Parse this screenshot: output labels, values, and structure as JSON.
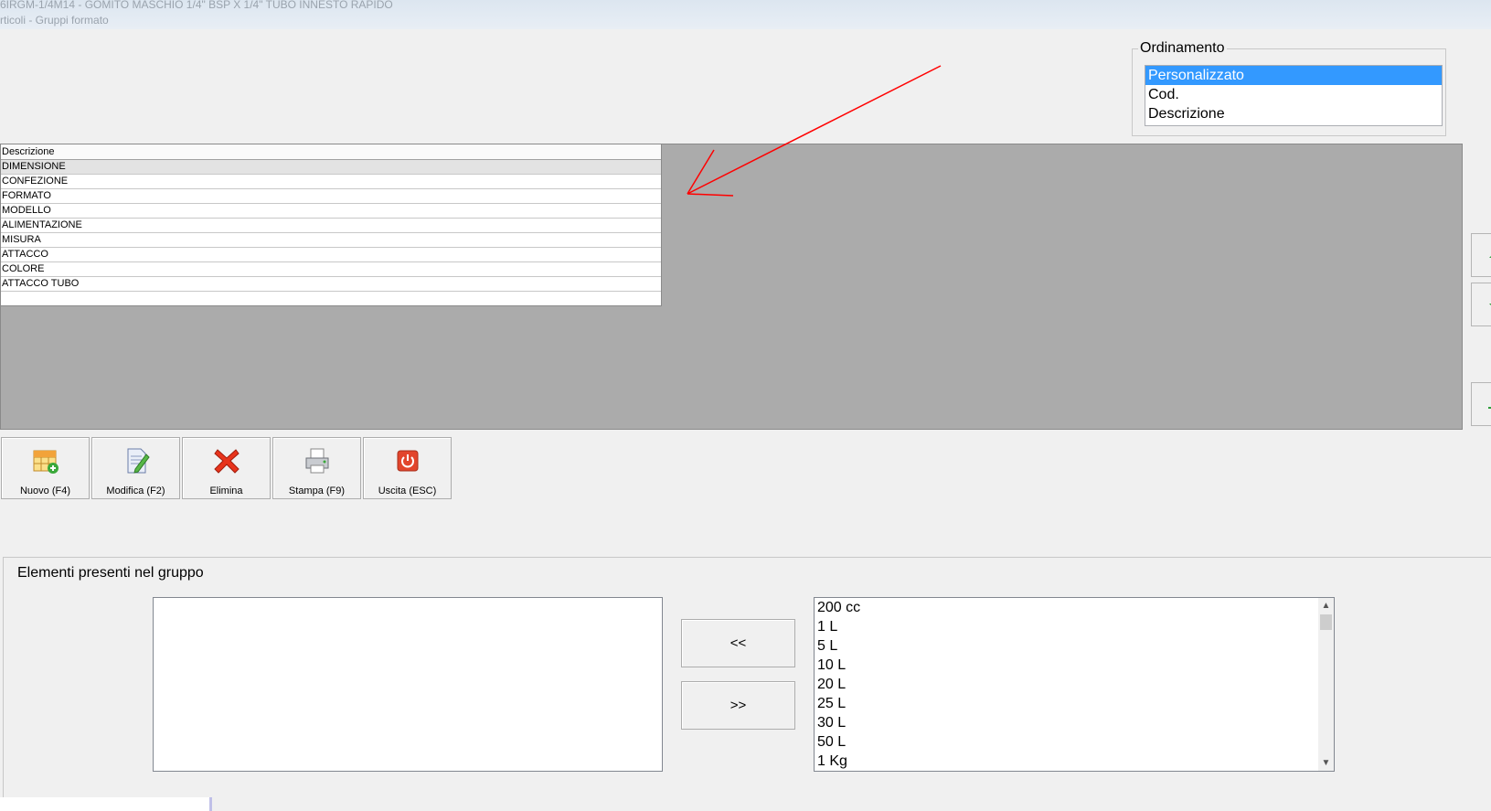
{
  "window": {
    "title": "6IRGM-1/4M14 - GOMITO MASCHIO 1/4\" BSP X 1/4\" TUBO INNESTO RAPIDO",
    "subtitle": "rticoli - Gruppi formato"
  },
  "ordinamento": {
    "label": "Ordinamento",
    "options": [
      "Personalizzato",
      "Cod.",
      "Descrizione"
    ],
    "selected_index": 0
  },
  "grid": {
    "header": "Descrizione",
    "rows": [
      "DIMENSIONE",
      "CONFEZIONE",
      "FORMATO",
      "MODELLO",
      "ALIMENTAZIONE",
      "MISURA",
      "ATTACCO",
      "COLORE",
      "ATTACCO TUBO"
    ],
    "selected_index": 0
  },
  "toolbar": {
    "new_label": "Nuovo (F4)",
    "edit_label": "Modifica (F2)",
    "delete_label": "Elimina",
    "print_label": "Stampa (F9)",
    "exit_label": "Uscita (ESC)"
  },
  "elements": {
    "title": "Elementi presenti nel gruppo",
    "move_left_label": "<<",
    "move_right_label": ">>",
    "available": [
      "200 cc",
      "1 L",
      "5 L",
      "10 L",
      "20 L",
      "25 L",
      "30 L",
      "50 L",
      "1 Kg"
    ]
  },
  "colors": {
    "selection": "#3399ff",
    "annotation_arrow": "#ff0000",
    "grid_background": "#ababab"
  }
}
